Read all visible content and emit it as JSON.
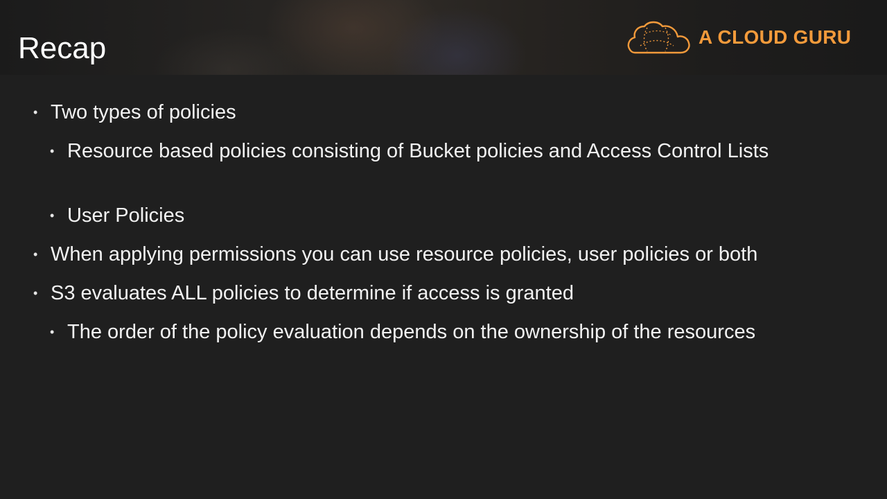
{
  "slide": {
    "title": "Recap"
  },
  "logo": {
    "text": "A CLOUD GURU",
    "icon": "cloud-logo-icon",
    "color": "#f39a3b"
  },
  "bullets": [
    {
      "level": 1,
      "text": "Two types of policies"
    },
    {
      "level": 2,
      "text": "Resource based policies consisting of Bucket policies and Access Control Lists"
    },
    {
      "level": 2,
      "text": "User Policies"
    },
    {
      "level": 1,
      "text": "When applying permissions you can use resource policies, user policies or both"
    },
    {
      "level": 1,
      "text": "S3 evaluates ALL policies to determine if access is granted"
    },
    {
      "level": 2,
      "text": "The order of the policy evaluation depends on the ownership of the resources"
    }
  ],
  "bullet_glyph": "•"
}
